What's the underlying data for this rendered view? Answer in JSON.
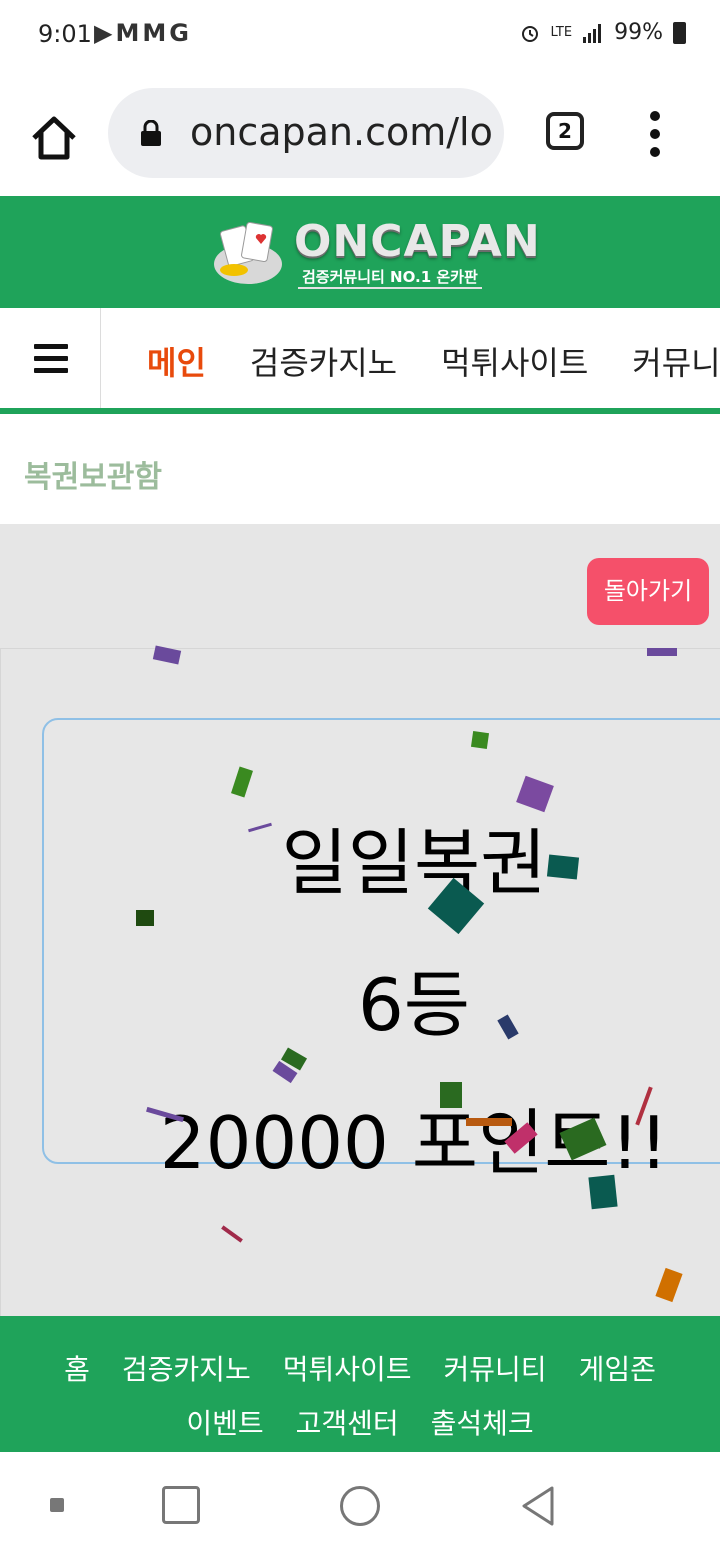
{
  "status": {
    "time": "9:01",
    "app_icons": "▶MMG",
    "network": "LTE",
    "battery": "99%"
  },
  "browser": {
    "url": "oncapan.com/lo",
    "tab_count": "2"
  },
  "site": {
    "logo_name": "ONCAPAN",
    "logo_tagline": "검증커뮤니티 NO.1 온카판"
  },
  "nav": {
    "items": [
      "메인",
      "검증카지노",
      "먹튀사이트",
      "커뮤니티"
    ],
    "active_index": 0
  },
  "page": {
    "title": "복권보관함",
    "back_button": "돌아가기"
  },
  "prize": {
    "name": "일일복권",
    "rank": "6등",
    "points": "20000 포인트!!"
  },
  "footer": {
    "row1": [
      "홈",
      "검증카지노",
      "먹튀사이트",
      "커뮤니티",
      "게임존"
    ],
    "row2": [
      "이벤트",
      "고객센터",
      "출석체크"
    ]
  },
  "colors": {
    "brand_green": "#1fa35a",
    "active_nav": "#e84a0c",
    "back_button": "#f5506a",
    "card_border": "#8fc0e6"
  }
}
